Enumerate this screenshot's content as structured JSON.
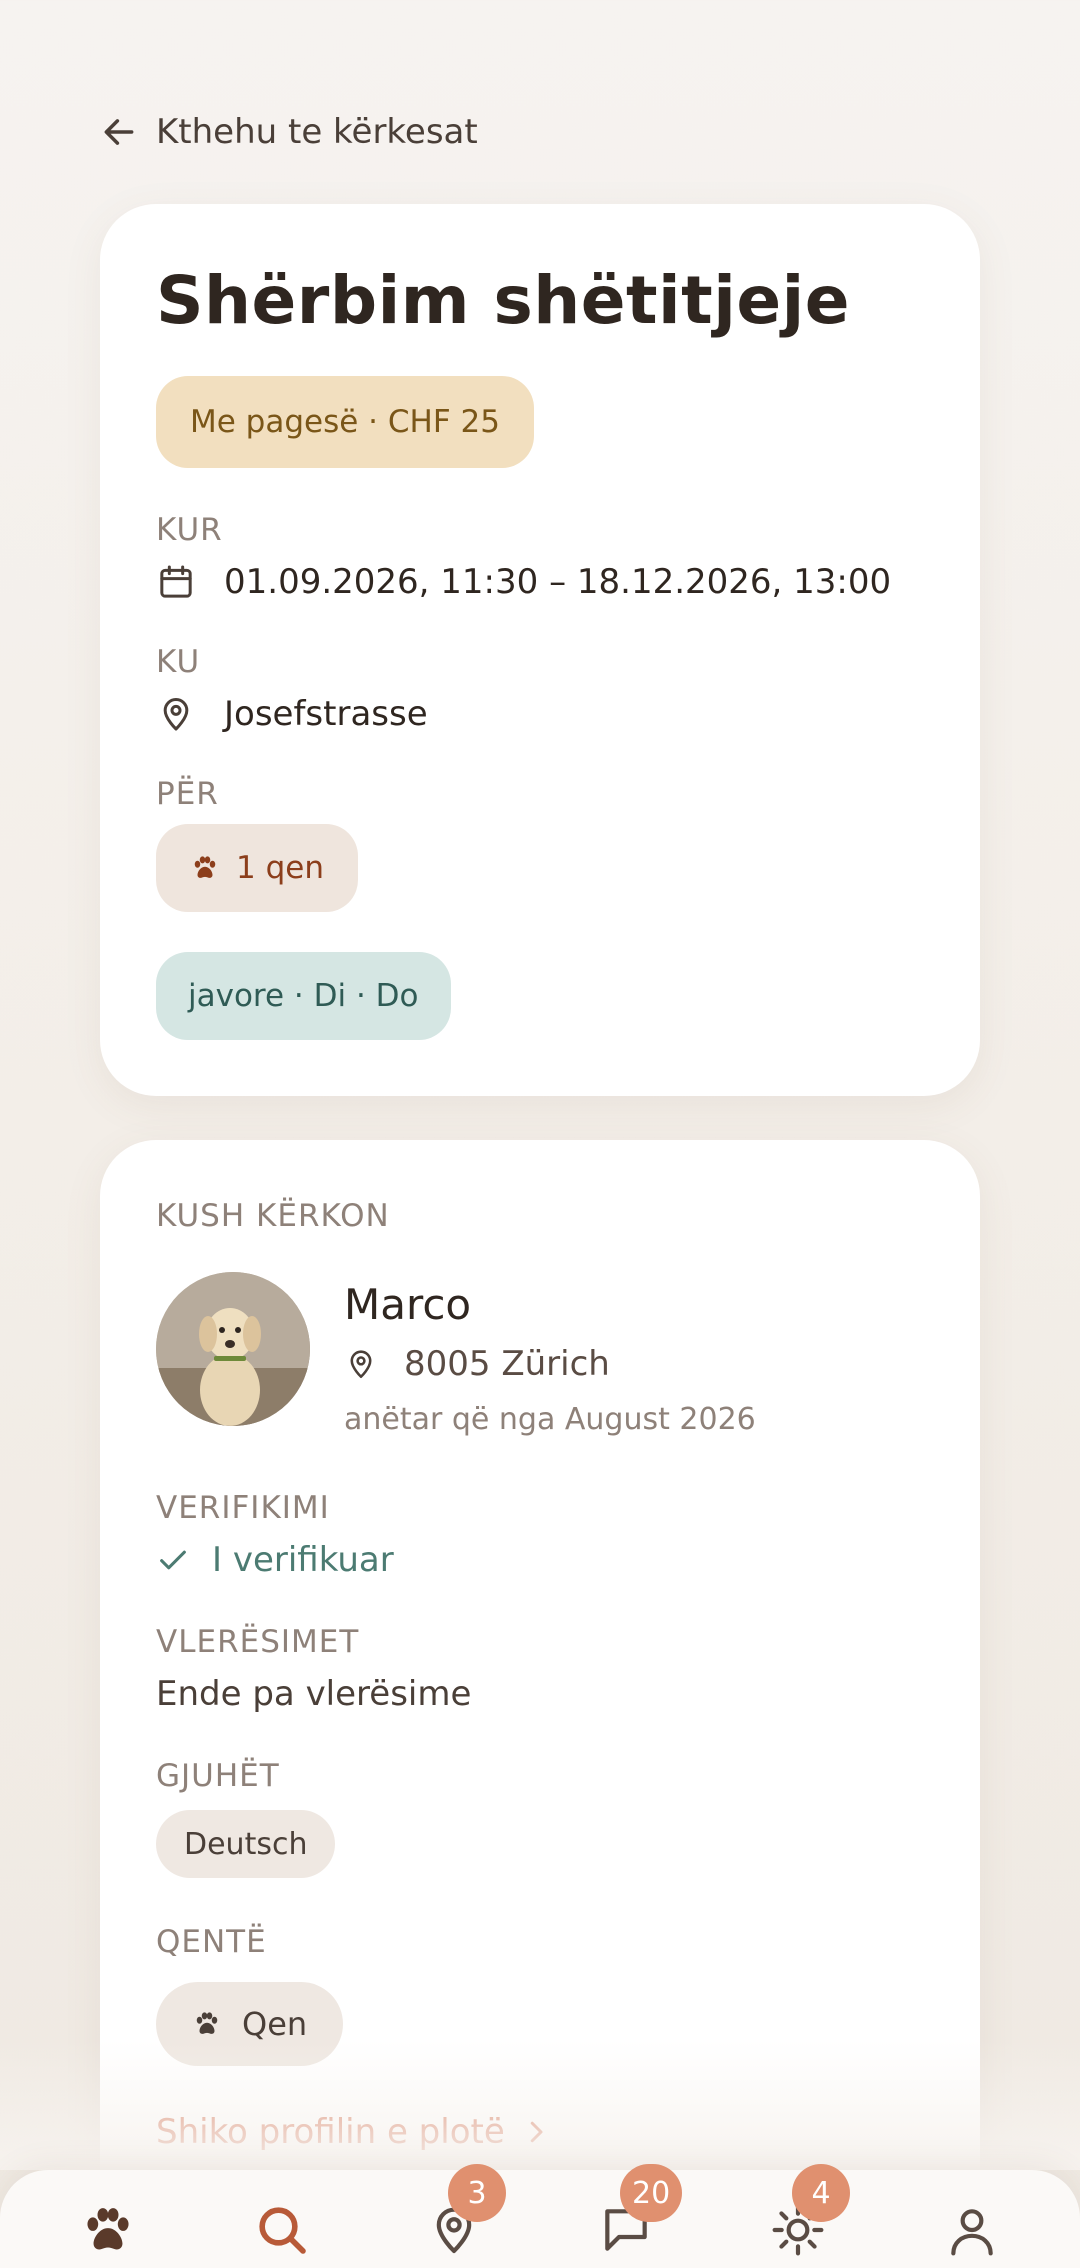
{
  "back_label": "Kthehu te kërkesat",
  "request": {
    "title": "Shërbim shëtitjeje",
    "price": "Me pagesë · CHF 25",
    "when_label": "KUR",
    "when_value": "01.09.2026, 11:30 – 18.12.2026, 13:00",
    "where_label": "KU",
    "where_value": "Josefstrasse",
    "for_label": "PËR",
    "for_value": "1 qen",
    "frequency": "javore · Di · Do"
  },
  "requester": {
    "section_label": "KUSH KËRKON",
    "name": "Marco",
    "location": "8005 Zürich",
    "member_since": "anëtar që nga August 2026",
    "verification_label": "VERIFIKIMI",
    "verification_value": "I verifikuar",
    "ratings_label": "VLERËSIMET",
    "ratings_value": "Ende pa vlerësime",
    "languages_label": "GJUHËT",
    "languages": [
      "Deutsch"
    ],
    "dogs_label": "QENTË",
    "dogs": [
      "Qen"
    ],
    "profile_link": "Shiko profilin e plotë"
  },
  "nav": {
    "items": [
      {
        "icon": "paw-icon",
        "badge": ""
      },
      {
        "icon": "search-icon",
        "badge": ""
      },
      {
        "icon": "map-pin-icon",
        "badge": "3"
      },
      {
        "icon": "chat-icon",
        "badge": "20"
      },
      {
        "icon": "sun-icon",
        "badge": "4"
      },
      {
        "icon": "profile-icon",
        "badge": ""
      }
    ]
  },
  "colors": {
    "accent": "#d9846a",
    "price_pill_bg": "#f2dfbf",
    "freq_pill_bg": "#d5e6e3",
    "verified": "#4c7b72",
    "badge": "#e0906f"
  }
}
